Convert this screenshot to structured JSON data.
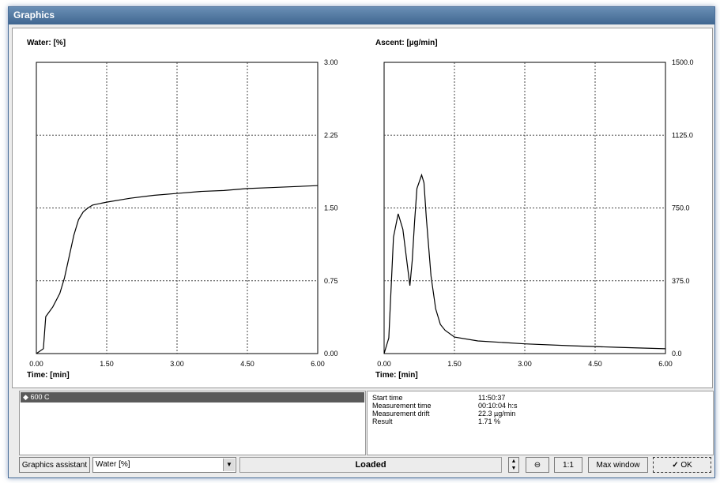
{
  "window": {
    "title": "Graphics"
  },
  "charts": [
    {
      "title": "Water: [%]",
      "xlabel": "Time: [min]",
      "x_ticks": [
        "0.00",
        "1.50",
        "3.00",
        "4.50",
        "6.00"
      ],
      "y_ticks": [
        "0.00",
        "0.75",
        "1.50",
        "2.25",
        "3.00"
      ]
    },
    {
      "title": "Ascent: [µg/min]",
      "xlabel": "Time: [min]",
      "x_ticks": [
        "0.00",
        "1.50",
        "3.00",
        "4.50",
        "6.00"
      ],
      "y_ticks": [
        "0.0",
        "375.0",
        "750.0",
        "1125.0",
        "1500.0"
      ]
    }
  ],
  "chart_data": [
    {
      "type": "line",
      "title": "Water: [%]",
      "xlabel": "Time: [min]",
      "ylabel": "",
      "xlim": [
        0,
        6
      ],
      "ylim": [
        0,
        3
      ],
      "grid": true,
      "x": [
        0,
        0.15,
        0.2,
        0.35,
        0.5,
        0.6,
        0.7,
        0.8,
        0.9,
        1.0,
        1.1,
        1.2,
        1.5,
        2.0,
        2.5,
        3.0,
        3.5,
        4.0,
        4.5,
        5.0,
        5.5,
        6.0
      ],
      "y": [
        0.0,
        0.05,
        0.38,
        0.48,
        0.62,
        0.78,
        1.0,
        1.22,
        1.38,
        1.46,
        1.5,
        1.53,
        1.56,
        1.6,
        1.63,
        1.65,
        1.67,
        1.68,
        1.7,
        1.71,
        1.72,
        1.73
      ]
    },
    {
      "type": "line",
      "title": "Ascent: [µg/min]",
      "xlabel": "Time: [min]",
      "ylabel": "",
      "xlim": [
        0,
        6
      ],
      "ylim": [
        0,
        1500
      ],
      "grid": true,
      "x": [
        0,
        0.1,
        0.2,
        0.3,
        0.4,
        0.55,
        0.6,
        0.65,
        0.7,
        0.8,
        0.85,
        0.9,
        1.0,
        1.1,
        1.2,
        1.3,
        1.5,
        2.0,
        3.0,
        4.0,
        5.0,
        6.0
      ],
      "y": [
        0,
        80,
        600,
        720,
        640,
        350,
        480,
        680,
        850,
        920,
        880,
        700,
        400,
        230,
        150,
        120,
        85,
        65,
        50,
        40,
        32,
        25
      ]
    }
  ],
  "legend_list": {
    "items": [
      {
        "label": "600 C"
      }
    ]
  },
  "info": {
    "rows": [
      {
        "key": "Start time",
        "value": "11:50:37"
      },
      {
        "key": "Measurement time",
        "value": "00:10:04 h:s"
      },
      {
        "key": "Measurement drift",
        "value": "22.3 µg/min"
      },
      {
        "key": "Result",
        "value": "1.71 %"
      }
    ]
  },
  "toolbar": {
    "assistant_label": "Graphics assistant",
    "combo_value": "Water [%]",
    "status": "Loaded",
    "zoom_fit_label": "1:1",
    "max_window_label": "Max window",
    "ok_label": "OK"
  }
}
